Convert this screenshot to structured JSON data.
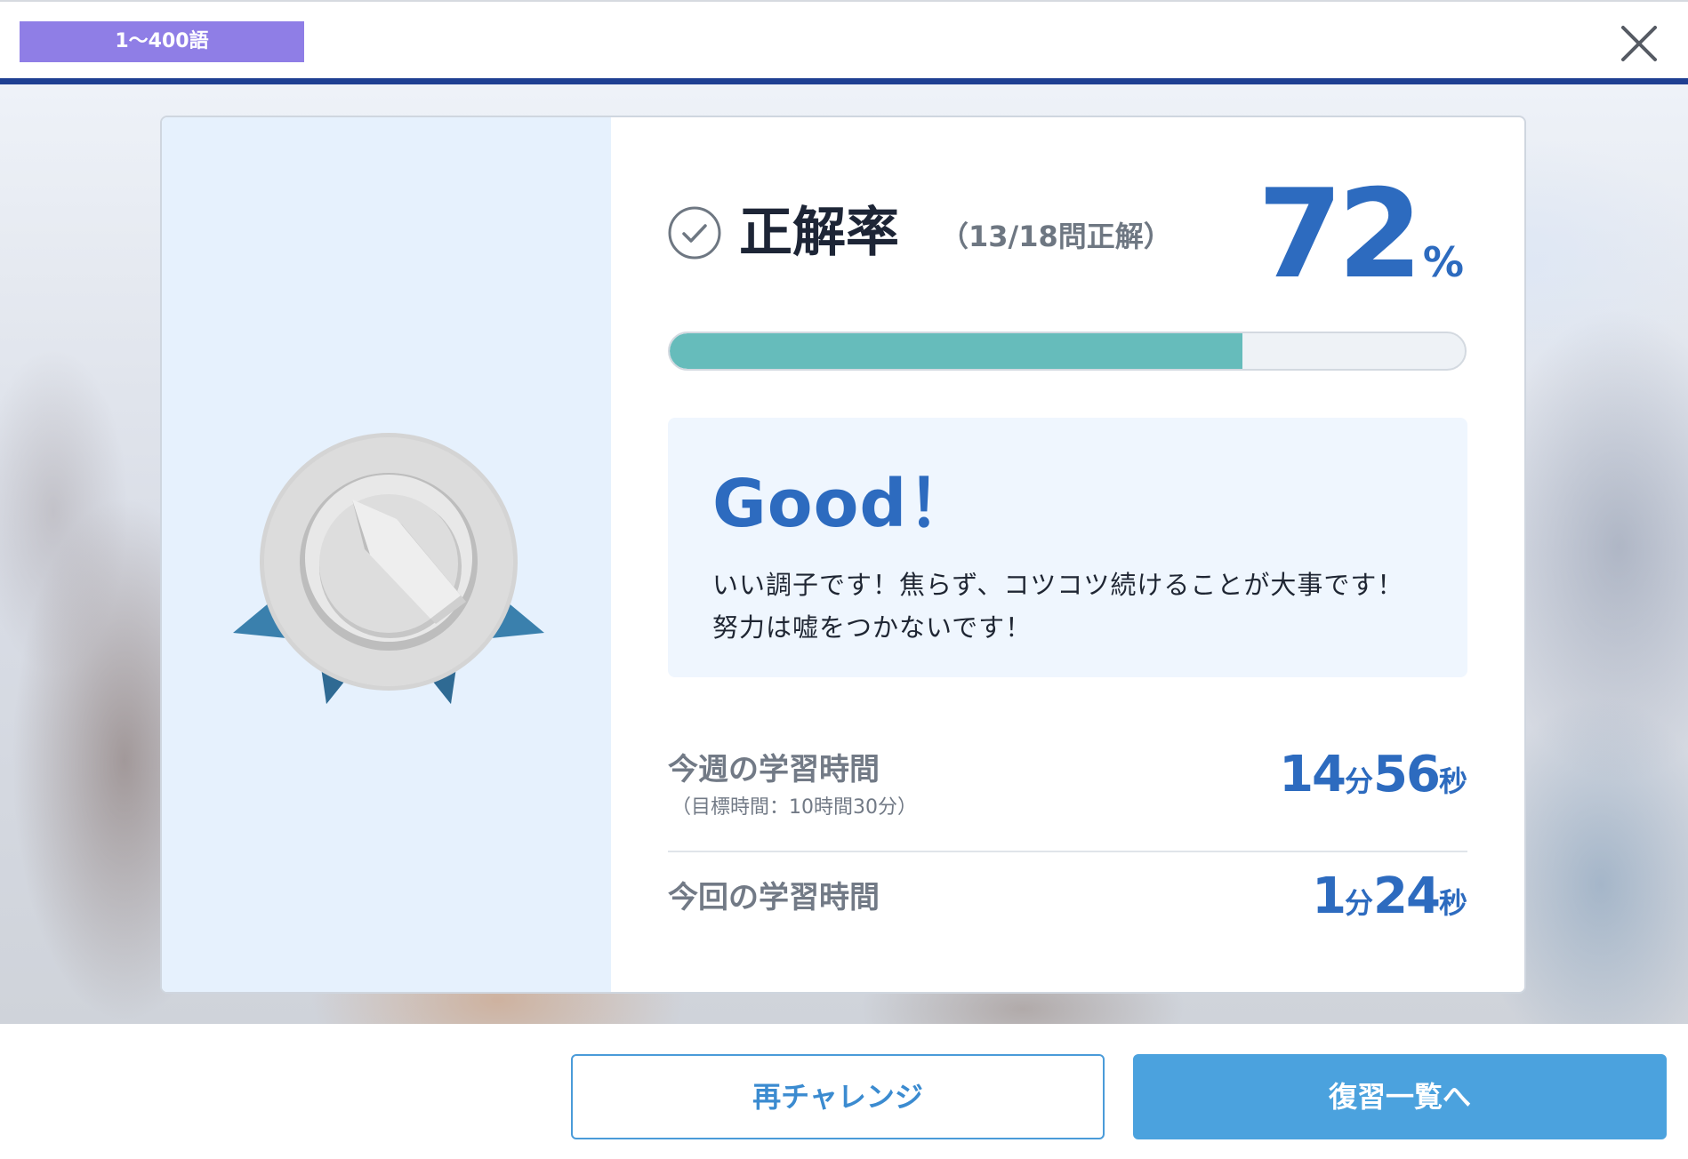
{
  "header": {
    "level_label": "1〜400語",
    "close_icon": "close-icon",
    "accent_color": "#1e3f92",
    "badge_color": "#8f7ee6"
  },
  "result": {
    "medal_icon": "silver-medal-icon",
    "check_icon": "check-circle-icon",
    "score_label": "正解率",
    "score_detail": "（13/18問正解）",
    "percent_value": "72",
    "percent_sign": "%",
    "progress_fraction": 0.72,
    "progress_color": "#66bcbb",
    "message": {
      "title": "Good！",
      "body": "いい調子です！焦らず、コツコツ続けることが大事です！努力は嘘をつかないです！"
    },
    "stats": {
      "week": {
        "label": "今週の学習時間",
        "sub": "（目標時間：10時間30分）",
        "min_num": "14",
        "min_unit": "分",
        "sec_num": "56",
        "sec_unit": "秒"
      },
      "session": {
        "label": "今回の学習時間",
        "min_num": "1",
        "min_unit": "分",
        "sec_num": "24",
        "sec_unit": "秒"
      }
    },
    "value_color": "#2d6bbf"
  },
  "footer": {
    "retry_label": "再チャレンジ",
    "review_label": "復習一覧へ"
  }
}
